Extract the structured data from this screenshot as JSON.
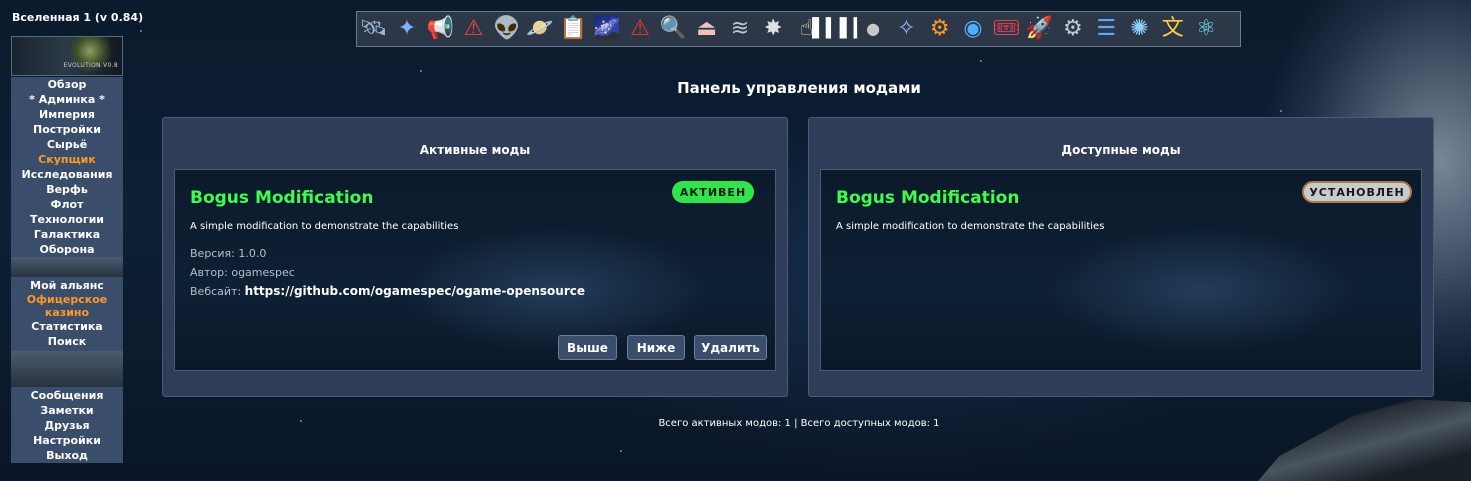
{
  "header": {
    "universe": "Вселенная 1",
    "version": "(v 0.84)",
    "logo_text": "EVOLUTION V0.8"
  },
  "menu": {
    "group1": [
      "Обзор",
      "* Админка *",
      "Империя",
      "Постройки",
      "Сырьё",
      "Скупщик",
      "Исследования",
      "Верфь",
      "Флот",
      "Технологии",
      "Галактика",
      "Оборона"
    ],
    "group2": [
      "Мой альянс",
      "Офицерское казино",
      "Статистика",
      "Поиск"
    ],
    "group3": [
      "Сообщения",
      "Заметки",
      "Друзья",
      "Настройки",
      "Выход"
    ]
  },
  "toolbar": {
    "icons": [
      "satellite-icon",
      "compass-icon",
      "megaphone-icon",
      "warning-hand-icon",
      "alien-icon",
      "planet-icon",
      "clipboard-icon",
      "galaxy-icon",
      "alert-icon",
      "magnifier-icon",
      "teleporter-icon",
      "wifi-icon",
      "explosion-icon",
      "hand-pointer-icon",
      "barcode-icon",
      "bot-icon",
      "starfield-icon",
      "gear-orange-icon",
      "neural-brain-icon",
      "ticket-icon",
      "rocket-icon",
      "settings-check-icon",
      "database-icon",
      "network-icon",
      "translate-icon",
      "atom-icon"
    ]
  },
  "page": {
    "title": "Панель управления модами"
  },
  "active_panel": {
    "title": "Активные моды",
    "mod": {
      "name": "Bogus Modification",
      "description": "A simple modification to demonstrate the capabilities",
      "status": "АКТИВЕН",
      "version_label": "Версия:",
      "version": "1.0.0",
      "author_label": "Автор:",
      "author": "ogamespec",
      "website_label": "Вебсайт:",
      "website": "https://github.com/ogamespec/ogame-opensource",
      "buttons": {
        "up": "Выше",
        "down": "Ниже",
        "delete": "Удалить"
      }
    }
  },
  "available_panel": {
    "title": "Доступные моды",
    "mod": {
      "name": "Bogus Modification",
      "description": "A simple modification to demonstrate the capabilities",
      "status": "УСТАНОВЛЕН"
    }
  },
  "footer": {
    "stats": "Всего активных модов: 1 | Всего доступных модов: 1"
  },
  "colors": {
    "accent_green": "#3bff4a",
    "active_badge": "#2fe64a",
    "menu_orange": "#ff9a1f",
    "panel_bg": "#2f3d58"
  }
}
